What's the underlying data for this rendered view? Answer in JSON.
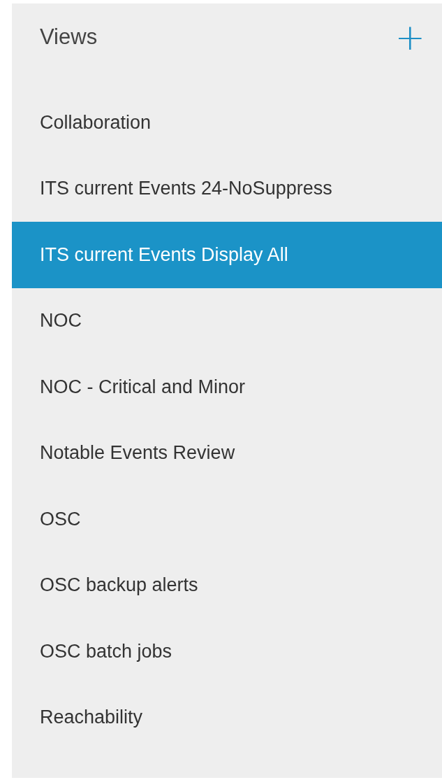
{
  "panel": {
    "title": "Views",
    "add_button": "+"
  },
  "views": [
    {
      "label": "Collaboration",
      "selected": false
    },
    {
      "label": "ITS current Events 24-NoSuppress",
      "selected": false
    },
    {
      "label": "ITS current Events Display All",
      "selected": true
    },
    {
      "label": "NOC",
      "selected": false
    },
    {
      "label": "NOC - Critical and Minor",
      "selected": false
    },
    {
      "label": "Notable Events Review",
      "selected": false
    },
    {
      "label": "OSC",
      "selected": false
    },
    {
      "label": "OSC backup alerts",
      "selected": false
    },
    {
      "label": "OSC batch jobs",
      "selected": false
    },
    {
      "label": "Reachability",
      "selected": false
    }
  ]
}
